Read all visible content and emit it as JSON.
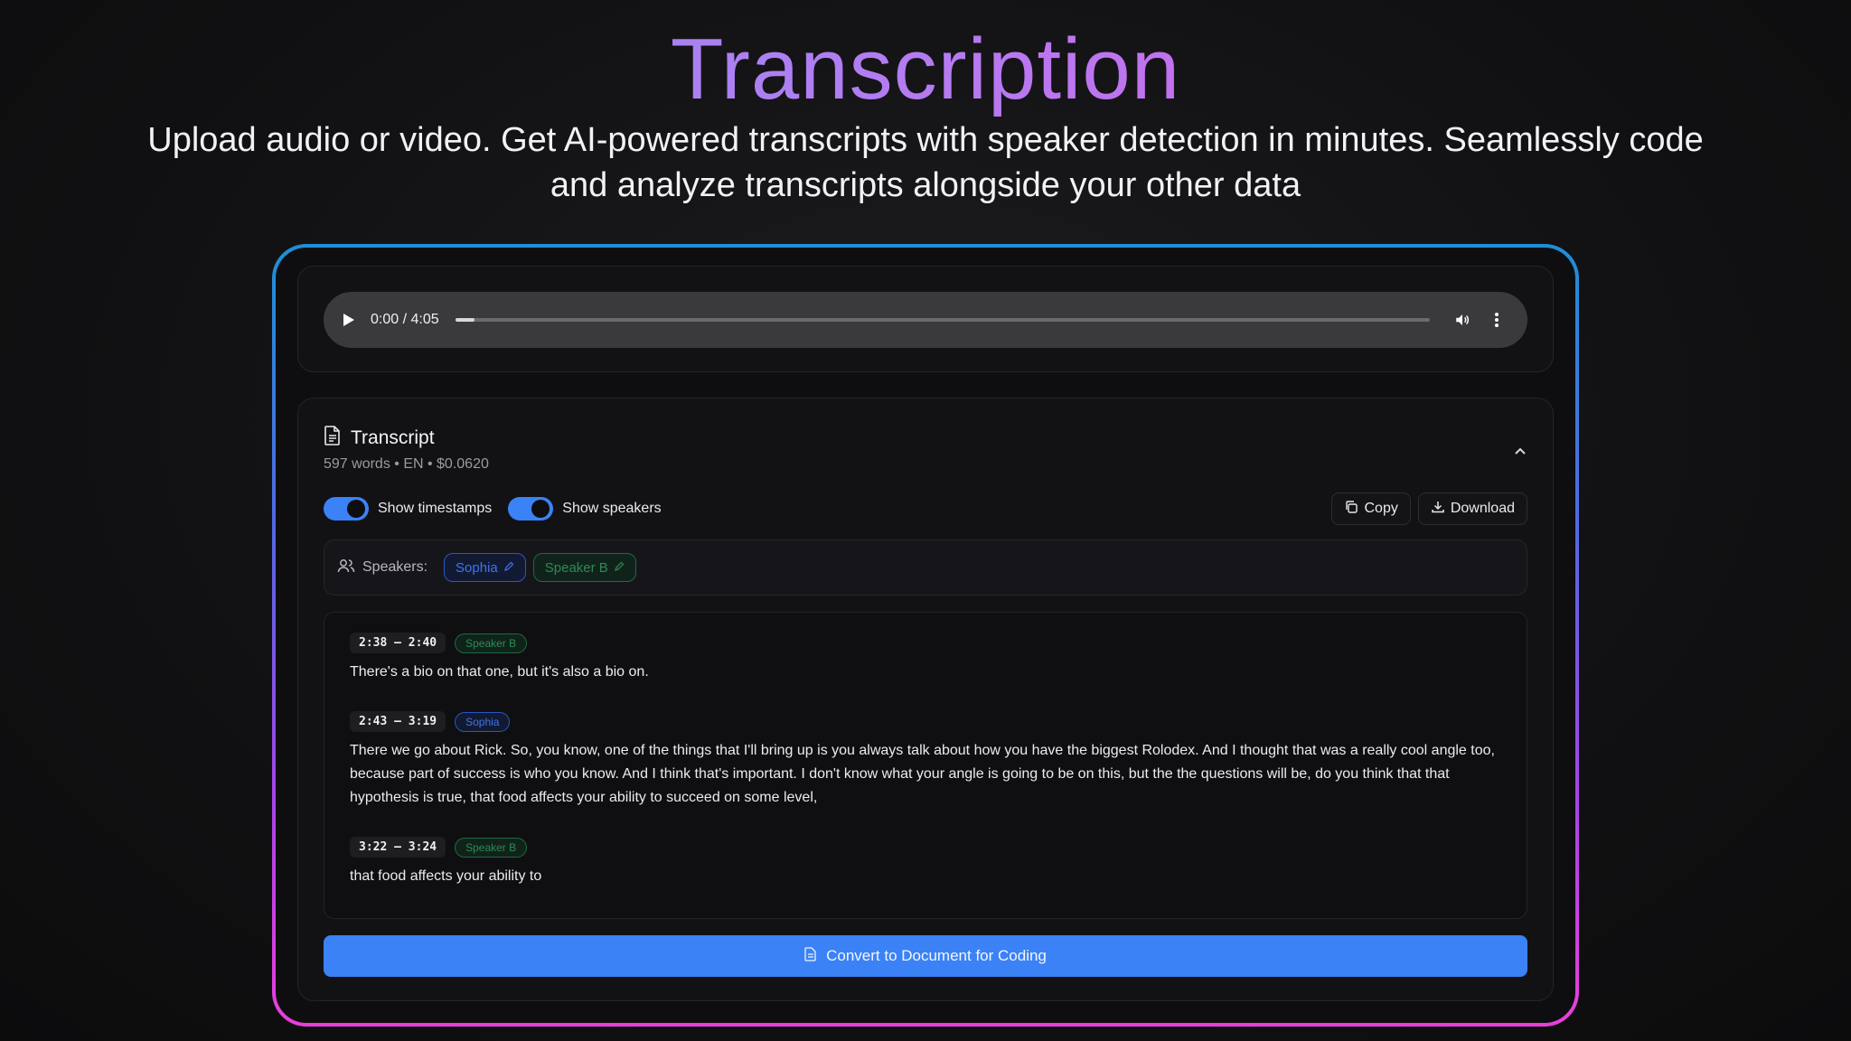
{
  "hero": {
    "title": "Transcription",
    "subtitle": "Upload audio or video. Get AI-powered transcripts with speaker detection in minutes. Seamlessly code and analyze transcripts alongside your other data"
  },
  "player": {
    "time": "0:00 / 4:05",
    "progress": 0.02,
    "icons": [
      "play-icon",
      "volume-icon",
      "more-vertical-icon"
    ]
  },
  "transcript": {
    "title": "Transcript",
    "meta": "597 words • EN • $0.0620",
    "toggles": {
      "timestamps_label": "Show timestamps",
      "timestamps_on": true,
      "speakers_label": "Show speakers",
      "speakers_on": true
    },
    "copy_label": "Copy",
    "download_label": "Download",
    "speakers_label": "Speakers:",
    "speakers": [
      {
        "name": "Sophia",
        "color": "#3f74ea"
      },
      {
        "name": "Speaker B",
        "color": "#2e8a54"
      }
    ],
    "segments": [
      {
        "time": "2:38 – 2:40",
        "speaker": "Speaker B",
        "text": "There's a bio on that one, but it's also a bio on."
      },
      {
        "time": "2:43 – 3:19",
        "speaker": "Sophia",
        "text": "There we go about Rick. So, you know, one of the things that I'll bring up is you always talk about how you have the biggest Rolodex. And I thought that was a really cool angle too, because part of success is who you know. And I think that's important. I don't know what your angle is going to be on this, but the the questions will be, do you think that that hypothesis is true, that food affects your ability to succeed on some level,"
      },
      {
        "time": "3:22 – 3:24",
        "speaker": "Speaker B",
        "text": "that food affects your ability to"
      }
    ],
    "convert_label": "Convert to Document for Coding"
  },
  "colors": {
    "accent": "#3b82f6",
    "title_gradient": [
      "#8f8ff5",
      "#e35ae6"
    ],
    "frame_gradient": [
      "#1f8fd6",
      "#e93fd9"
    ]
  }
}
